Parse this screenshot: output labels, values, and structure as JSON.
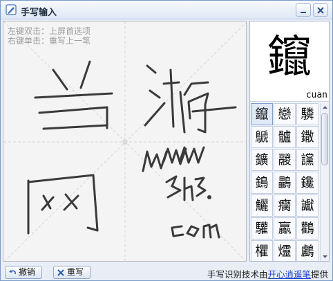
{
  "window": {
    "title": "手写输入"
  },
  "pad": {
    "hint_left": "左键双击：上屏首选项",
    "hint_right": "右键单击：重写上一笔"
  },
  "candidates": {
    "top": {
      "char": "鑹",
      "pinyin": "cuan"
    },
    "grid": [
      "鑹",
      "戀",
      "驎",
      "鷈",
      "髗",
      "鏾",
      "鑛",
      "鬷",
      "讜",
      "鵭",
      "鸓",
      "鑱",
      "鱺",
      "癵",
      "讞",
      "驩",
      "鸁",
      "鸛",
      "欋",
      "爧",
      "鸕"
    ]
  },
  "bottom": {
    "undo_label": "撤销",
    "rewrite_label": "重写",
    "credit_prefix": "手写识别技术由",
    "credit_link": "开心逍遥笔",
    "credit_suffix": "提供"
  },
  "colors": {
    "accent": "#1c3fd0",
    "border": "#7a9cc8",
    "close_red": "#c8202a"
  }
}
